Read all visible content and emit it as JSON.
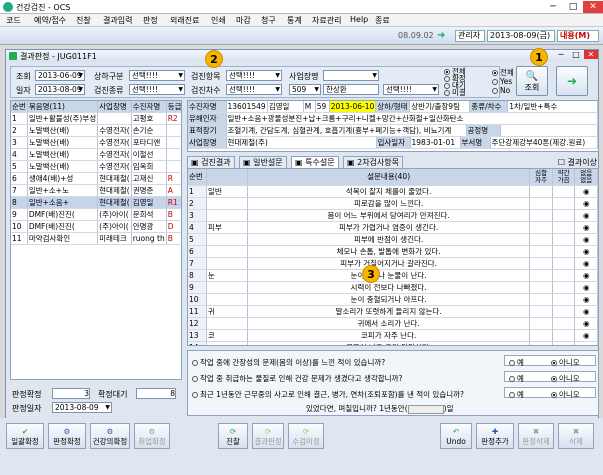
{
  "window": {
    "title": "건강검진 - OCS",
    "controls": [
      "─",
      "□",
      "✕"
    ]
  },
  "menu": [
    "코드",
    "예약/접수",
    "진찰",
    "결과입력",
    "판정",
    "외래진료",
    "인쇄",
    "마감",
    "청구",
    "통계",
    "자료관리",
    "Help",
    "종료"
  ],
  "toolbar": {
    "date": "08.09.02",
    "user": "관리자",
    "current_date": "2013-08-09(금)",
    "status": "내용(M)"
  },
  "child": {
    "title": "결과판정 - JUG011F1",
    "controls": [
      "─",
      "□",
      "✕"
    ]
  },
  "filter": {
    "row1": {
      "label_jo": "조회",
      "date": "2013-06-09",
      "label_sangha": "상하구분",
      "sangha_val": "선택!!!!",
      "label_gumjin": "검진항목",
      "gumjin_val": "선택!!!!",
      "label_saup": "사업장명"
    },
    "row2": {
      "label_ilja": "일자",
      "date": "2013-08-09",
      "label_result": "검진종류",
      "result_val": "선택!!!!",
      "label_chasu": "검진차수",
      "chasu_val": "선택!!!!",
      "code_val": "509",
      "code_name": "한상환",
      "extra_val": "선택!!!!"
    },
    "radio1": [
      "전체",
      "확정",
      "대기",
      "미결"
    ],
    "radio2": [
      "전체",
      "Yes",
      "No"
    ],
    "search_button": "조회"
  },
  "left_grid": {
    "headers": [
      "순번",
      "묶음명(11)",
      "사업장명",
      "수진자명",
      "등급",
      "판정"
    ],
    "rows": [
      [
        "1",
        "일반+활불성(주)부성",
        "",
        "고평호",
        "R2",
        "○"
      ],
      [
        "2",
        "노말백산(배)",
        "수영전자(",
        "손기순",
        "",
        ""
      ],
      [
        "3",
        "노말백산(배)",
        "수영전자(",
        "포타디앤",
        "",
        ""
      ],
      [
        "4",
        "노말백산(배)",
        "수영전자(",
        "이철선",
        "",
        ""
      ],
      [
        "5",
        "노말백산(배)",
        "수영전자(",
        "임옥희",
        "",
        ""
      ],
      [
        "6",
        "생애4(배)+성",
        "현대제철(",
        "고재신",
        "R",
        ""
      ],
      [
        "7",
        "일반+소+노",
        "현대제철(",
        "권명준",
        "A",
        ""
      ],
      [
        "8",
        "일반+소음+",
        "현대제철(",
        "김영일",
        "R1",
        ""
      ],
      [
        "9",
        "DMF(배)진진(",
        "(주)아이(",
        "문희석",
        "B",
        ""
      ],
      [
        "10",
        "DMF(배)진진(",
        "(주)아이(",
        "안명광",
        "D",
        ""
      ],
      [
        "11",
        "마약검사확인",
        "미래테크",
        "ruong th",
        "B",
        "○"
      ]
    ],
    "selected_index": 7,
    "summary": {
      "label_done": "판정확정",
      "done": "3",
      "label_wait": "확정대기",
      "wait": "8"
    },
    "date_label": "판정일자",
    "date": "2013-08-09"
  },
  "info": {
    "rows": [
      [
        "수진자명",
        "13601549",
        "김영일",
        "M",
        "59",
        "2013-06-10",
        "상하/형태",
        "상반기/출장9팀",
        "종류/차수",
        "1차/일반+특수"
      ],
      [
        "유해인자",
        "일반+소음+광물성분진+납+크롬+구리+니켈+망간+산화철+일산화탄소"
      ],
      [
        "표적장기",
        "조혈기계, 간담도계, 심혈관계, 호흡기계(흉부+폐기능+객담), 비뇨기계",
        "공정명",
        ""
      ],
      [
        "사업장명",
        "현대제철(주)",
        "입사일자",
        "1983-01-01",
        "부서명",
        "주단강제강부40톤(제강.원료)"
      ]
    ]
  },
  "tabs": [
    "검진결과",
    "일반설문",
    "특수설문",
    "2차검사항목"
  ],
  "active_tab": 2,
  "result_check": "결과이상",
  "question_grid": {
    "headers": [
      "순번",
      "",
      "설문내용(40)",
      "심함",
      "약간",
      "없음"
    ],
    "sub_headers": [
      "자주",
      "가끔",
      "없음"
    ],
    "rows": [
      [
        "1",
        "일반",
        "석목이 잘지 체를이 줄었다.",
        "",
        "",
        "◉"
      ],
      [
        "2",
        "",
        "피로감을 많이 느낀다.",
        "",
        "",
        "◉"
      ],
      [
        "3",
        "",
        "몸이 어느 부위에서 당여리가 만져진다.",
        "",
        "",
        "◉"
      ],
      [
        "4",
        "피부",
        "피부가 가렵거나 염증이 생긴다.",
        "",
        "",
        "◉"
      ],
      [
        "5",
        "",
        "피부에 반점이 생긴다.",
        "",
        "",
        "◉"
      ],
      [
        "6",
        "",
        "체모나 손톱, 발톱에 변화가 있다.",
        "",
        "",
        "◉"
      ],
      [
        "7",
        "",
        "피부가 거칠어지거나 갈라진다.",
        "",
        "",
        "◉"
      ],
      [
        "8",
        "눈",
        "눈이시거나 눈물이 난다.",
        "",
        "",
        "◉"
      ],
      [
        "9",
        "",
        "시력이 전보다 나빠졌다.",
        "",
        "",
        "◉"
      ],
      [
        "10",
        "",
        "눈이 충혈되거나 아프다.",
        "",
        "",
        "◉"
      ],
      [
        "11",
        "귀",
        "말소리가 또렷하게 들리지 않는다.",
        "",
        "",
        "◉"
      ],
      [
        "12",
        "",
        "귀에서 소리가 난다.",
        "",
        "",
        "◉"
      ],
      [
        "13",
        "코",
        "코피가 자주 난다.",
        "",
        "",
        "◉"
      ],
      [
        "14",
        "",
        "콧물이 나고 코가 답답하다.",
        "",
        "",
        "◉"
      ]
    ]
  },
  "extra_questions": [
    {
      "q": "작업 중에 간장성의 문제(몸의 이상)를 느낀 적이 있습니까?",
      "yes": "예",
      "no": "아니오"
    },
    {
      "q": "작업 중 취급하는 물질로 인해 건강 문제가 생겼다고 생각합니까?",
      "yes": "예",
      "no": "아니오"
    },
    {
      "q": "최근 1년동안 근무중의 사고로 인해 결근, 병가, 연차(조퇴포함)를 낸 적이 있습니까?",
      "yes": "예",
      "no": "아니오"
    }
  ],
  "extra_tail": {
    "text": "있었다면, 며칠입니까? 1년동안(",
    "unit": ")일"
  },
  "bottom_buttons": [
    "일괄확정",
    "판정확정",
    "건강의확정",
    "취업확정",
    "진찰",
    "결과판정",
    "수검미정",
    "Undo",
    "판정추가",
    "판정삭제",
    "삭제"
  ],
  "badges": [
    "1",
    "2",
    "3"
  ]
}
